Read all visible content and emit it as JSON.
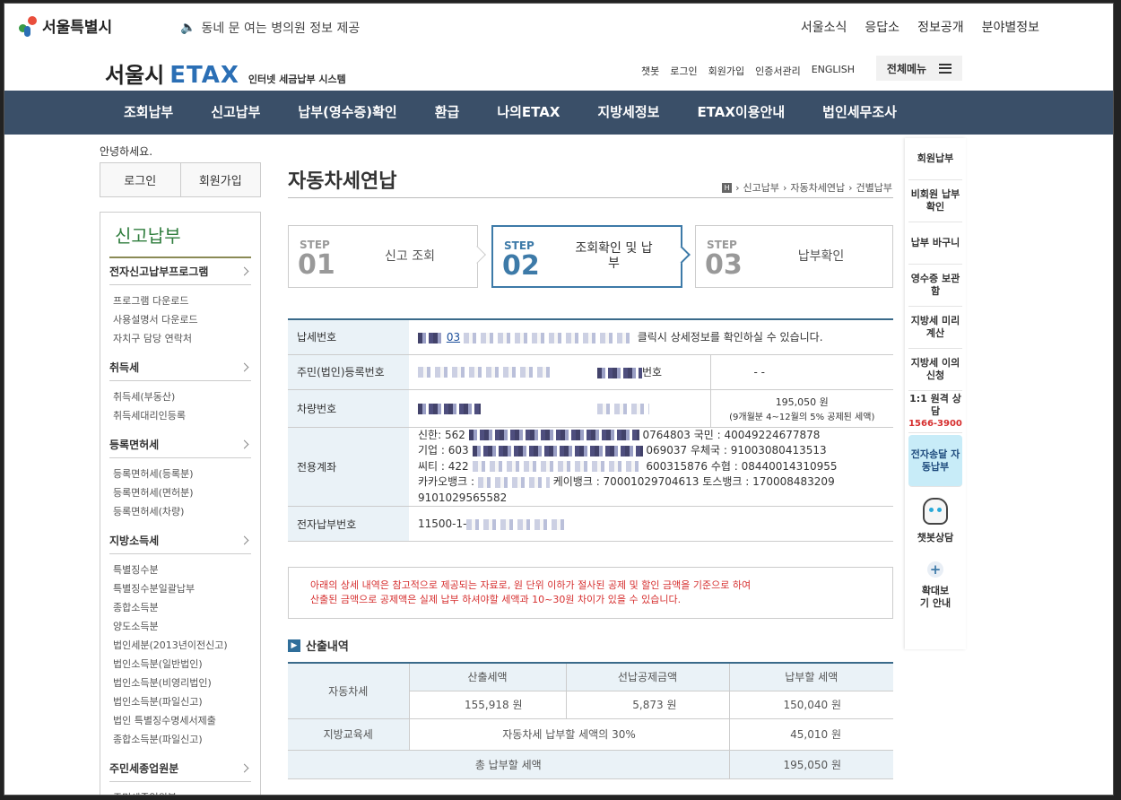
{
  "top": {
    "logo": "서울특별시",
    "notice": "동네 문 여는 병의원 정보 제공",
    "links": [
      "서울소식",
      "응답소",
      "정보공개",
      "분야별정보"
    ]
  },
  "brand": {
    "city": "서울시",
    "name": "ETAX",
    "sub": "인터넷 세금납부 시스템"
  },
  "utility": {
    "links": [
      "챗봇",
      "로그인",
      "회원가입",
      "인증서관리",
      "ENGLISH"
    ],
    "all_menu": "전체메뉴"
  },
  "gnb": [
    "조회납부",
    "신고납부",
    "납부(영수증)확인",
    "환급",
    "나의ETAX",
    "지방세정보",
    "ETAX이용안내",
    "법인세무조사"
  ],
  "left": {
    "hello": "안녕하세요.",
    "login": "로그인",
    "join": "회원가입",
    "title": "신고납부",
    "sections": [
      {
        "title": "전자신고납부프로그램",
        "items": [
          "프로그램 다운로드",
          "사용설명서 다운로드",
          "자치구 담당 연락처"
        ]
      },
      {
        "title": "취득세",
        "items": [
          "취득세(부동산)",
          "취득세대리인등록"
        ]
      },
      {
        "title": "등록면허세",
        "items": [
          "등록면허세(등록분)",
          "등록면허세(면허분)",
          "등록면허세(차량)"
        ]
      },
      {
        "title": "지방소득세",
        "items": [
          "특별징수분",
          "특별징수분일괄납부",
          "종합소득분",
          "양도소득분",
          "법인세분(2013년이전신고)",
          "법인소득분(일반법인)",
          "법인소득분(비영리법인)",
          "법인소득분(파일신고)",
          "법인 특별징수명세서제출",
          "종합소득분(파일신고)"
        ]
      },
      {
        "title": "주민세종업원분",
        "items": [
          "주민세종업원분"
        ]
      }
    ]
  },
  "page": {
    "title": "자동차세연납",
    "breadcrumb": [
      "신고납부",
      "자동차세연납",
      "건별납부"
    ]
  },
  "steps": [
    {
      "label": "STEP",
      "num": "01",
      "name": "신고 조회",
      "active": false
    },
    {
      "label": "STEP",
      "num": "02",
      "name": "조회확인 및 납부",
      "active": true
    },
    {
      "label": "STEP",
      "num": "03",
      "name": "납부확인",
      "active": false
    }
  ],
  "info": {
    "tax_no_label": "납세번호",
    "tax_no_visible": "03",
    "tax_no_note": "클릭시 상세정보를 확인하실 수 있습니다.",
    "id_label": "주민(법인)등록번호",
    "id_right_label": "번호",
    "id_right_value": "-      -",
    "car_label": "차량번호",
    "car_amount": "195,050 원",
    "car_amount_note": "(9개월분 4~12월의 5% 공제된 세액)",
    "account_label": "전용계좌",
    "accounts": [
      "신한: 562",
      "0764803    국민      : 40049224677878",
      "기업 : 603",
      "069037      우체국 : 91003080413513",
      "씨티 : 422",
      "600315876  수협    : 08440014310955",
      "카카오뱅크 :",
      "케이뱅크 : 70001029704613  토스뱅크 : 170008483209",
      "9101029565582"
    ],
    "epay_label": "전자납부번호",
    "epay_visible": "11500-1-"
  },
  "notice_box": [
    "아래의 상세 내역은 참고적으로 제공되는 자료로, 원 단위 이하가 절사된 공제 및 할인 금액을 기준으로 하여",
    "산출된 금액으로 공제액은 실제 납부 하셔야할 세액과 10~30원 차이가 있을 수 있습니다."
  ],
  "calc": {
    "title": "산출내역",
    "headers": [
      "산출세액",
      "선납공제금액",
      "납부할 세액"
    ],
    "car_tax_label": "자동차세",
    "car_tax": [
      "155,918 원",
      "5,873 원",
      "150,040 원"
    ],
    "edu_label": "지방교육세",
    "edu_desc": "자동차세 납부할 세액의 30%",
    "edu_amount": "45,010 원",
    "total_label": "총 납부할 세액",
    "total_amount": "195,050 원"
  },
  "quick": {
    "items": [
      "회원납부",
      "비회원 납부확인",
      "납부 바구니",
      "영수증 보관함",
      "지방세 미리계산",
      "지방세 이의신청"
    ],
    "call_title": "1:1 원격 상담",
    "call_tel": "1566-3900",
    "auto_pay": "전자송달 자동납부",
    "chatbot": "챗봇상담",
    "zoom": "확대보기 안내"
  }
}
